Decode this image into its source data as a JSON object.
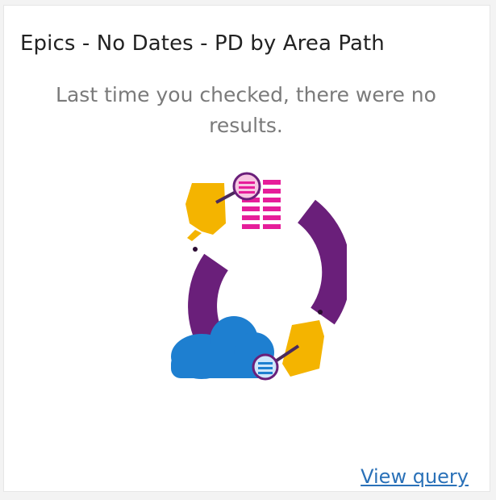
{
  "widget": {
    "title": "Epics - No Dates - PD by Area Path",
    "message": "Last time you checked, there were no results.",
    "link": "View query",
    "illustration": "query-no-results-illustration"
  },
  "colors": {
    "purple": "#6a1f7a",
    "yellow": "#f4b400",
    "magenta": "#e61e9a",
    "blue": "#1e7fd0",
    "link": "#2a71b8"
  }
}
